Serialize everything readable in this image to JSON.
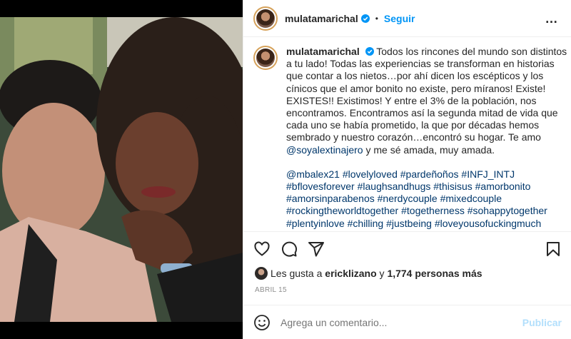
{
  "post": {
    "username": "mulatamarichal",
    "separator": "•",
    "follow_label": "Seguir",
    "more_icon": "…",
    "caption": {
      "text": "Todos los rincones del mundo son distintos a tu lado! Todas las experiencias se transforman en historias que contar a los nietos…por ahí dicen los escépticos y los cínicos que el amor bonito no existe, pero míranos! Existe! EXISTES!! Existimos! Y entre el 3% de la población, nos encontramos. Encontramos así la segunda mitad de vida que cada uno se había prometido, la que por décadas hemos sembrado y nuestro corazón…encontró su hogar. Te amo ",
      "mention": "@soyalextinajero",
      "text_after": " y me sé amada, muy amada.",
      "hashtags": [
        "@mbalex21",
        "#lovelyloved",
        "#pardeñoños",
        "#INFJ_INTJ",
        "#bflovesforever",
        "#laughsandhugs",
        "#thisisus",
        "#amorbonito",
        "#amorsinparabenos",
        "#nerdycouple",
        "#mixedcouple",
        "#rockingtheworldtogether",
        "#togetherness",
        "#sohappytogether",
        "#plentyinlove",
        "#chilling",
        "#justbeing",
        "#loveyousofuckingmuch"
      ]
    },
    "likes": {
      "prefix": "Les gusta a",
      "liker": "ericklizano",
      "conj": "y",
      "count": "1,774 personas más"
    },
    "date": "ABRIL 15",
    "comment": {
      "placeholder": "Agrega un comentario...",
      "publish_label": "Publicar"
    }
  },
  "icons": [
    "verified-badge-icon",
    "heart-icon",
    "comment-icon",
    "share-icon",
    "bookmark-icon",
    "emoji-icon",
    "more-options-icon"
  ],
  "colors": {
    "link": "#00376b",
    "accent": "#0095f6",
    "publish_disabled": "#b2dffc",
    "muted": "#8e8e8e"
  }
}
